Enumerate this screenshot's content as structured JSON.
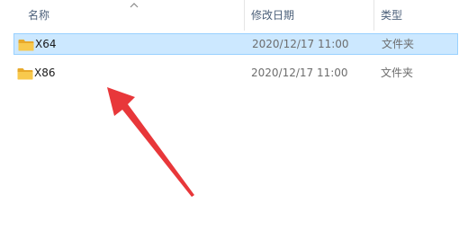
{
  "columns": {
    "name": "名称",
    "date": "修改日期",
    "type": "类型"
  },
  "sort": {
    "icon": "chevron-up-icon",
    "direction": "ascending"
  },
  "rows": [
    {
      "name": "X64",
      "date": "2020/12/17 11:00",
      "type": "文件夹",
      "icon": "folder-icon",
      "selected": true
    },
    {
      "name": "X86",
      "date": "2020/12/17 11:00",
      "type": "文件夹",
      "icon": "folder-icon",
      "selected": false
    }
  ],
  "colors": {
    "selection_bg": "#cce8ff",
    "selection_border": "#99d1ff",
    "folder": "#f8c94d",
    "annotation_arrow": "#e8373a"
  }
}
